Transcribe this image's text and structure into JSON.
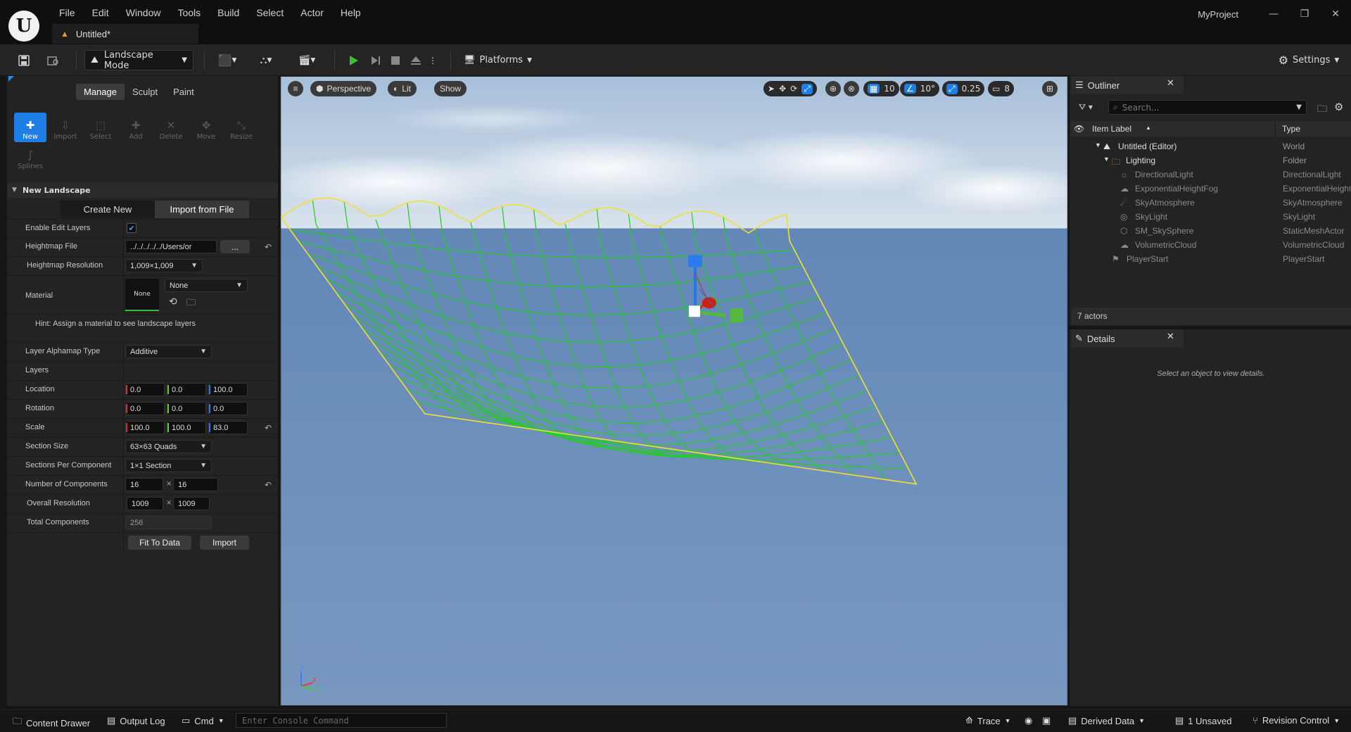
{
  "titlebar": {
    "menu": [
      "File",
      "Edit",
      "Window",
      "Tools",
      "Build",
      "Select",
      "Actor",
      "Help"
    ],
    "doc_tab": "Untitled*",
    "project_name": "MyProject"
  },
  "toolbar": {
    "mode_label": "Landscape Mode",
    "platforms_label": "Platforms",
    "settings_label": "Settings"
  },
  "landscape_panel": {
    "mode_tabs": [
      "Manage",
      "Sculpt",
      "Paint"
    ],
    "active_mode_tab": "Manage",
    "tools": [
      "New",
      "Import",
      "Select",
      "Add",
      "Delete",
      "Move",
      "Resize",
      "Splines"
    ],
    "active_tool": "New",
    "section_title": "New Landscape",
    "create_tabs": [
      "Create New",
      "Import from File"
    ],
    "active_create_tab": "Import from File",
    "enable_edit_layers": {
      "label": "Enable Edit Layers",
      "checked": true
    },
    "heightmap_file": {
      "label": "Heightmap File",
      "value": "../../../../../Users/or",
      "browse": "..."
    },
    "heightmap_resolution": {
      "label": "Heightmap Resolution",
      "value": "1,009×1,009"
    },
    "material": {
      "label": "Material",
      "thumb": "None",
      "value": "None"
    },
    "hint": "Hint: Assign a material to see landscape layers",
    "layer_alphamap_type": {
      "label": "Layer Alphamap Type",
      "value": "Additive"
    },
    "layers": {
      "label": "Layers"
    },
    "location": {
      "label": "Location",
      "x": "0.0",
      "y": "0.0",
      "z": "100.0"
    },
    "rotation": {
      "label": "Rotation",
      "x": "0.0",
      "y": "0.0",
      "z": "0.0"
    },
    "scale": {
      "label": "Scale",
      "x": "100.0",
      "y": "100.0",
      "z": "83.0"
    },
    "section_size": {
      "label": "Section Size",
      "value": "63×63 Quads"
    },
    "sections_per_component": {
      "label": "Sections Per Component",
      "value": "1×1 Section"
    },
    "number_of_components": {
      "label": "Number of Components",
      "x": "16",
      "y": "16",
      "sep": "×"
    },
    "overall_resolution": {
      "label": "Overall Resolution",
      "x": "1009",
      "y": "1009",
      "sep": "×"
    },
    "total_components": {
      "label": "Total Components",
      "value": "256"
    },
    "fit_to_data": "Fit To Data",
    "import": "Import"
  },
  "viewport": {
    "view_mode": "Perspective",
    "lighting": "Lit",
    "show": "Show",
    "grid_snap": "10",
    "rotation_snap": "10°",
    "scale_snap": "0.25",
    "camera_speed": "8",
    "gizmo_axes": [
      "Z",
      "X",
      "Y"
    ]
  },
  "outliner": {
    "title": "Outliner",
    "search_placeholder": "Search...",
    "col_label": "Item Label",
    "col_type": "Type",
    "rows": [
      {
        "label": "Untitled (Editor)",
        "type": "World"
      },
      {
        "label": "Lighting",
        "type": "Folder"
      },
      {
        "label": "DirectionalLight",
        "type": "DirectionalLight"
      },
      {
        "label": "ExponentialHeightFog",
        "type": "ExponentialHeightFog"
      },
      {
        "label": "SkyAtmosphere",
        "type": "SkyAtmosphere"
      },
      {
        "label": "SkyLight",
        "type": "SkyLight"
      },
      {
        "label": "SM_SkySphere",
        "type": "StaticMeshActor"
      },
      {
        "label": "VolumetricCloud",
        "type": "VolumetricCloud"
      },
      {
        "label": "PlayerStart",
        "type": "PlayerStart"
      }
    ],
    "actor_count": "7 actors"
  },
  "details": {
    "title": "Details",
    "hint": "Select an object to view details."
  },
  "statusbar": {
    "content_drawer": "Content Drawer",
    "output_log": "Output Log",
    "cmd": "Cmd",
    "console_placeholder": "Enter Console Command",
    "trace": "Trace",
    "derived_data": "Derived Data",
    "unsaved": "1 Unsaved",
    "revision_control": "Revision Control"
  },
  "colors": {
    "accent": "#1f7ee6",
    "wire_green": "#22cc22",
    "wire_yellow": "#f0e030",
    "sky_top": "#9fb9d6",
    "ground": "#6a8fbe"
  }
}
